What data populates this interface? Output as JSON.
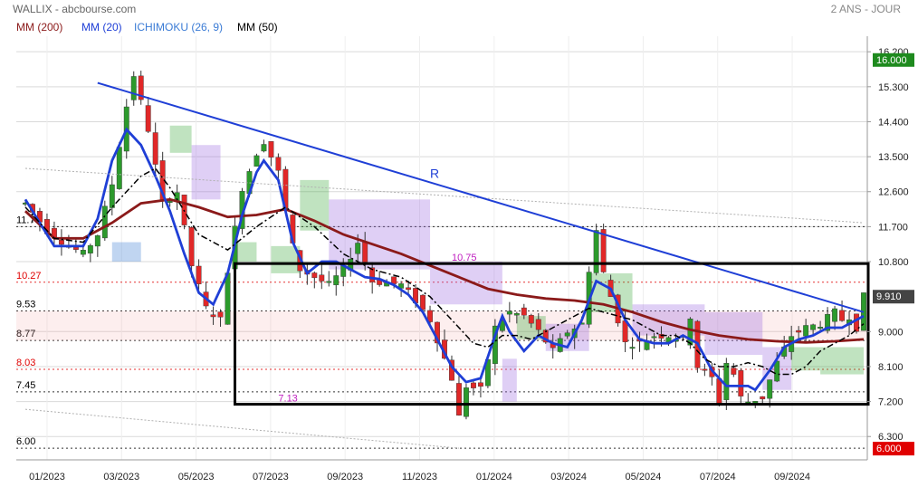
{
  "header": {
    "title": "WALLIX - abcbourse.com",
    "period": "2 ANS - JOUR",
    "legend": [
      {
        "label": "MM (200)",
        "color": "#8b1a1a"
      },
      {
        "label": "MM (20)",
        "color": "#1f3fd6"
      },
      {
        "label": "ICHIMOKU (26, 9)",
        "color": "#3a7bd5"
      },
      {
        "label": "MM (50)",
        "color": "#000000"
      }
    ]
  },
  "chart_data": {
    "type": "candlestick",
    "ylim": [
      5.7,
      16.6
    ],
    "y_ticks": [
      "16.200",
      "15.300",
      "14.400",
      "13.500",
      "12.600",
      "11.700",
      "10.800",
      "9.000",
      "8.100",
      "7.200",
      "6.300"
    ],
    "x_ticks": [
      "01/2023",
      "03/2023",
      "05/2023",
      "07/2023",
      "09/2023",
      "11/2023",
      "01/2024",
      "03/2024",
      "05/2024",
      "07/2024",
      "09/2024"
    ],
    "last_price": "9.910",
    "price_labels": [
      {
        "text": "16.000",
        "color": "#1e8a1e"
      },
      {
        "text": "6.000",
        "color": "#e00000"
      }
    ],
    "levels": [
      {
        "text": "11.70",
        "value": 11.7,
        "color": "#000000"
      },
      {
        "text": "10.27",
        "value": 10.27,
        "color": "#e00000"
      },
      {
        "text": "9.53",
        "value": 9.53,
        "color": "#000000"
      },
      {
        "text": "8.77",
        "value": 8.77,
        "color": "#000000"
      },
      {
        "text": "8.03",
        "value": 8.03,
        "color": "#e00000"
      },
      {
        "text": "7.45",
        "value": 7.45,
        "color": "#000000"
      },
      {
        "text": "6.00",
        "value": 6.0,
        "color": "#000000"
      }
    ],
    "annotations": [
      {
        "text": "R",
        "color": "#1f3fd6"
      },
      {
        "text": "10.75",
        "color": "#c020c0"
      },
      {
        "text": "7.13",
        "color": "#c020c0"
      }
    ],
    "close_path": [
      [
        0,
        12.3
      ],
      [
        3,
        11.6
      ],
      [
        6,
        11.2
      ],
      [
        8,
        11.0
      ],
      [
        10,
        11.5
      ],
      [
        12,
        12.8
      ],
      [
        14,
        14.8
      ],
      [
        15,
        15.6
      ],
      [
        17,
        14.2
      ],
      [
        19,
        12.3
      ],
      [
        21,
        12.6
      ],
      [
        23,
        10.7
      ],
      [
        25,
        9.6
      ],
      [
        27,
        9.3
      ],
      [
        28,
        10.6
      ],
      [
        30,
        12.7
      ],
      [
        32,
        13.6
      ],
      [
        33,
        13.9
      ],
      [
        35,
        13.1
      ],
      [
        37,
        11.2
      ],
      [
        38,
        10.6
      ],
      [
        40,
        10.4
      ],
      [
        42,
        10.2
      ],
      [
        44,
        10.6
      ],
      [
        46,
        11.3
      ],
      [
        48,
        10.3
      ],
      [
        50,
        10.25
      ],
      [
        52,
        10.2
      ],
      [
        54,
        9.8
      ],
      [
        56,
        9.3
      ],
      [
        58,
        8.3
      ],
      [
        59,
        7.8
      ],
      [
        60,
        6.8
      ],
      [
        61,
        7.6
      ],
      [
        63,
        7.5
      ],
      [
        65,
        9.1
      ],
      [
        67,
        9.5
      ],
      [
        69,
        9.4
      ],
      [
        71,
        9.0
      ],
      [
        73,
        8.5
      ],
      [
        75,
        9.0
      ],
      [
        77,
        9.2
      ],
      [
        78,
        10.6
      ],
      [
        79,
        11.6
      ],
      [
        80,
        10.5
      ],
      [
        81,
        9.9
      ],
      [
        83,
        8.7
      ],
      [
        85,
        8.7
      ],
      [
        87,
        8.9
      ],
      [
        89,
        8.9
      ],
      [
        91,
        8.8
      ],
      [
        92,
        9.4
      ],
      [
        93,
        8.1
      ],
      [
        95,
        7.8
      ],
      [
        96,
        7.2
      ],
      [
        97,
        8.2
      ],
      [
        98,
        7.9
      ],
      [
        99,
        7.3
      ],
      [
        100,
        7.2
      ],
      [
        102,
        7.3
      ],
      [
        104,
        8.2
      ],
      [
        106,
        8.9
      ],
      [
        108,
        9.1
      ],
      [
        110,
        9.2
      ],
      [
        112,
        9.5
      ],
      [
        113,
        9.3
      ],
      [
        114,
        9.4
      ],
      [
        115,
        9.1
      ],
      [
        116,
        9.9
      ]
    ],
    "series": [
      {
        "name": "MM (200)",
        "color": "#8b1a1a",
        "points": [
          [
            0,
            12.1
          ],
          [
            4,
            11.4
          ],
          [
            8,
            11.4
          ],
          [
            12,
            11.8
          ],
          [
            16,
            12.3
          ],
          [
            20,
            12.4
          ],
          [
            24,
            12.2
          ],
          [
            28,
            11.95
          ],
          [
            32,
            12.0
          ],
          [
            36,
            12.15
          ],
          [
            40,
            11.85
          ],
          [
            44,
            11.5
          ],
          [
            48,
            11.25
          ],
          [
            52,
            11.0
          ],
          [
            56,
            10.7
          ],
          [
            60,
            10.4
          ],
          [
            64,
            10.1
          ],
          [
            68,
            9.95
          ],
          [
            72,
            9.85
          ],
          [
            76,
            9.8
          ],
          [
            80,
            9.7
          ],
          [
            84,
            9.5
          ],
          [
            88,
            9.25
          ],
          [
            92,
            9.05
          ],
          [
            96,
            8.9
          ],
          [
            100,
            8.8
          ],
          [
            104,
            8.75
          ],
          [
            108,
            8.72
          ],
          [
            112,
            8.75
          ],
          [
            116,
            8.8
          ]
        ]
      },
      {
        "name": "MM (20)",
        "color": "#1f3fd6",
        "points": [
          [
            0,
            12.4
          ],
          [
            4,
            11.2
          ],
          [
            8,
            11.2
          ],
          [
            10,
            11.9
          ],
          [
            12,
            13.4
          ],
          [
            14,
            14.2
          ],
          [
            16,
            13.8
          ],
          [
            18,
            13.0
          ],
          [
            20,
            12.1
          ],
          [
            22,
            11.0
          ],
          [
            24,
            10.0
          ],
          [
            26,
            9.7
          ],
          [
            28,
            10.5
          ],
          [
            30,
            12.0
          ],
          [
            32,
            13.1
          ],
          [
            33,
            13.4
          ],
          [
            35,
            12.9
          ],
          [
            37,
            11.3
          ],
          [
            39,
            10.5
          ],
          [
            41,
            10.8
          ],
          [
            43,
            10.8
          ],
          [
            45,
            10.6
          ],
          [
            47,
            10.4
          ],
          [
            49,
            10.35
          ],
          [
            51,
            10.2
          ],
          [
            53,
            9.95
          ],
          [
            55,
            9.5
          ],
          [
            57,
            8.8
          ],
          [
            59,
            8.1
          ],
          [
            61,
            7.7
          ],
          [
            63,
            7.8
          ],
          [
            65,
            8.9
          ],
          [
            66,
            9.4
          ],
          [
            67,
            9.0
          ],
          [
            69,
            8.5
          ],
          [
            71,
            8.9
          ],
          [
            73,
            8.7
          ],
          [
            75,
            8.6
          ],
          [
            77,
            9.3
          ],
          [
            79,
            10.3
          ],
          [
            81,
            10.1
          ],
          [
            83,
            9.3
          ],
          [
            85,
            8.8
          ],
          [
            87,
            8.7
          ],
          [
            89,
            8.7
          ],
          [
            91,
            8.9
          ],
          [
            93,
            8.7
          ],
          [
            95,
            8.0
          ],
          [
            97,
            7.6
          ],
          [
            98,
            7.6
          ],
          [
            100,
            7.6
          ],
          [
            101,
            7.5
          ],
          [
            103,
            8.0
          ],
          [
            105,
            8.6
          ],
          [
            107,
            8.8
          ],
          [
            109,
            8.9
          ],
          [
            111,
            9.1
          ],
          [
            113,
            9.1
          ],
          [
            114,
            9.2
          ],
          [
            116,
            9.4
          ]
        ]
      },
      {
        "name": "MM (50)",
        "color": "#000000",
        "points": [
          [
            0,
            12.2
          ],
          [
            4,
            11.4
          ],
          [
            8,
            11.3
          ],
          [
            12,
            12.2
          ],
          [
            16,
            13.0
          ],
          [
            18,
            13.2
          ],
          [
            20,
            12.7
          ],
          [
            24,
            11.5
          ],
          [
            28,
            11.1
          ],
          [
            32,
            11.7
          ],
          [
            36,
            12.2
          ],
          [
            40,
            11.7
          ],
          [
            44,
            11.0
          ],
          [
            48,
            10.6
          ],
          [
            52,
            10.4
          ],
          [
            56,
            9.9
          ],
          [
            60,
            9.1
          ],
          [
            62,
            8.7
          ],
          [
            64,
            8.6
          ],
          [
            66,
            8.9
          ],
          [
            68,
            8.9
          ],
          [
            70,
            8.8
          ],
          [
            72,
            9.0
          ],
          [
            74,
            9.2
          ],
          [
            76,
            9.4
          ],
          [
            78,
            9.6
          ],
          [
            80,
            9.5
          ],
          [
            82,
            9.4
          ],
          [
            84,
            9.3
          ],
          [
            86,
            9.1
          ],
          [
            88,
            8.9
          ],
          [
            90,
            8.9
          ],
          [
            92,
            8.7
          ],
          [
            94,
            8.3
          ],
          [
            96,
            8.1
          ],
          [
            98,
            8.1
          ],
          [
            100,
            8.2
          ],
          [
            102,
            8.1
          ],
          [
            104,
            7.9
          ],
          [
            106,
            7.9
          ],
          [
            108,
            8.1
          ],
          [
            110,
            8.5
          ],
          [
            112,
            8.7
          ],
          [
            114,
            8.9
          ],
          [
            116,
            9.2
          ]
        ]
      }
    ],
    "ichimoku_cloud": [
      {
        "x0": 12,
        "x1": 16,
        "top": 11.3,
        "bottom": 10.8,
        "color": "#3a7bd5"
      },
      {
        "x0": 20,
        "x1": 23,
        "top": 14.3,
        "bottom": 13.6,
        "color": "#3aa83a"
      },
      {
        "x0": 23,
        "x1": 27,
        "top": 13.8,
        "bottom": 12.4,
        "color": "#9b6be0"
      },
      {
        "x0": 29,
        "x1": 32,
        "top": 11.3,
        "bottom": 10.8,
        "color": "#3aa83a"
      },
      {
        "x0": 34,
        "x1": 38,
        "top": 11.2,
        "bottom": 10.5,
        "color": "#3aa83a"
      },
      {
        "x0": 38,
        "x1": 42,
        "top": 12.9,
        "bottom": 11.6,
        "color": "#3aa83a"
      },
      {
        "x0": 42,
        "x1": 56,
        "top": 12.4,
        "bottom": 10.6,
        "color": "#9b6be0"
      },
      {
        "x0": 56,
        "x1": 66,
        "top": 10.8,
        "bottom": 9.7,
        "color": "#9b6be0"
      },
      {
        "x0": 66,
        "x1": 68,
        "top": 8.3,
        "bottom": 7.2,
        "color": "#9b6be0"
      },
      {
        "x0": 68,
        "x1": 72,
        "top": 9.4,
        "bottom": 8.8,
        "color": "#3aa83a"
      },
      {
        "x0": 72,
        "x1": 78,
        "top": 9.2,
        "bottom": 8.5,
        "color": "#9b6be0"
      },
      {
        "x0": 78,
        "x1": 84,
        "top": 10.5,
        "bottom": 9.5,
        "color": "#3aa83a"
      },
      {
        "x0": 84,
        "x1": 94,
        "top": 9.7,
        "bottom": 8.9,
        "color": "#9b6be0"
      },
      {
        "x0": 94,
        "x1": 102,
        "top": 9.5,
        "bottom": 8.4,
        "color": "#9b6be0"
      },
      {
        "x0": 102,
        "x1": 106,
        "top": 8.6,
        "bottom": 7.5,
        "color": "#9b6be0"
      },
      {
        "x0": 106,
        "x1": 110,
        "top": 8.6,
        "bottom": 8.0,
        "color": "#3aa83a"
      },
      {
        "x0": 110,
        "x1": 116,
        "top": 8.6,
        "bottom": 7.9,
        "color": "#3aa83a"
      }
    ],
    "overlays": {
      "resistance_line": {
        "from": [
          10,
          15.4
        ],
        "to": [
          116,
          9.5
        ],
        "label": "R"
      },
      "range_box": {
        "x0": 29,
        "x1": 116,
        "top": 10.75,
        "bottom": 7.13
      },
      "range_label_top": "10.75",
      "range_label_bottom": "7.13",
      "upper_faint_line": {
        "from": [
          0,
          13.2
        ],
        "to": [
          116,
          11.8
        ]
      },
      "lower_faint_line": {
        "from": [
          0,
          7.0
        ],
        "to": [
          60,
          6.0
        ]
      }
    },
    "colors": {
      "up": "#2c9a2c",
      "down": "#e12828",
      "grid": "#d9d9d9",
      "axis": "#9a9a9a"
    }
  }
}
